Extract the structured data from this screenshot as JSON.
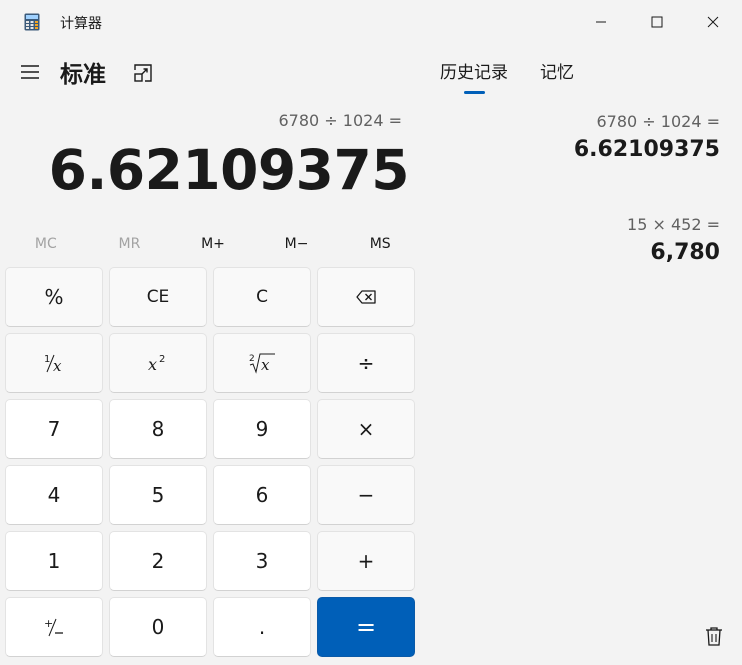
{
  "window": {
    "title": "计算器"
  },
  "header": {
    "mode_title": "标准"
  },
  "tabs": [
    {
      "label": "历史记录",
      "active": true
    },
    {
      "label": "记忆",
      "active": false
    }
  ],
  "display": {
    "expression": "6780 ÷ 1024 =",
    "value": "6.62109375"
  },
  "memory": [
    {
      "label": "MC",
      "enabled": false
    },
    {
      "label": "MR",
      "enabled": false
    },
    {
      "label": "M+",
      "enabled": true
    },
    {
      "label": "M−",
      "enabled": true
    },
    {
      "label": "MS",
      "enabled": true
    }
  ],
  "keys": {
    "percent": "%",
    "ce": "CE",
    "c": "C",
    "divide": "÷",
    "multiply": "×",
    "subtract": "−",
    "add": "+",
    "equals": "=",
    "digit_7": "7",
    "digit_8": "8",
    "digit_9": "9",
    "digit_4": "4",
    "digit_5": "5",
    "digit_6": "6",
    "digit_1": "1",
    "digit_2": "2",
    "digit_3": "3",
    "digit_0": "0",
    "decimal": "."
  },
  "history": [
    {
      "expression": "6780   ÷   1024 =",
      "result": "6.62109375"
    },
    {
      "expression": "15   ×   452 =",
      "result": "6,780"
    }
  ],
  "colors": {
    "accent": "#005fb8",
    "background": "#f3f3f3"
  },
  "icons": {
    "app": "calculator-icon",
    "menu": "hamburger-icon",
    "keep_on_top": "keep-on-top-icon",
    "backspace": "backspace-icon",
    "delete_history": "trash-icon"
  }
}
